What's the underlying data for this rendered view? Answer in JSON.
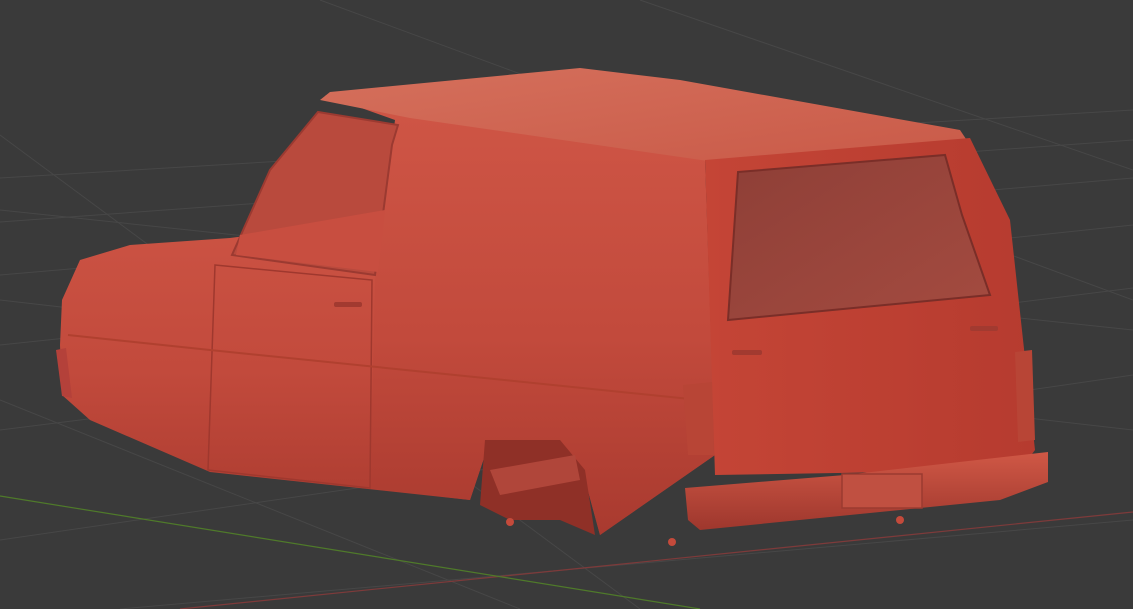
{
  "viewport": {
    "type": "3d-viewport",
    "background_color": "#3a3a3a",
    "grid_color": "#4a4a4a",
    "x_axis_color": "#8a3b3b",
    "y_axis_color": "#5d8a2f",
    "object": {
      "kind": "mesh",
      "description_icon": "three-wheeler-van-body",
      "color": "#c54a3d",
      "shadow_color": "#a8352b",
      "highlight_color": "#d6614f",
      "window_color": "#8a3a33"
    }
  }
}
